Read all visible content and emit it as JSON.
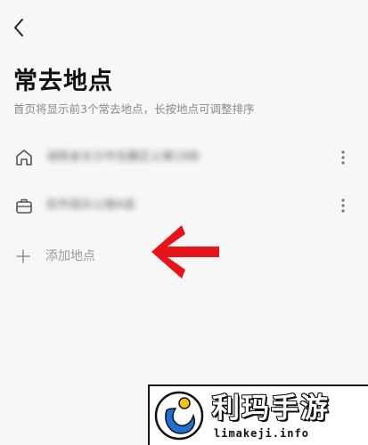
{
  "header": {
    "back_icon": "chevron-left-icon",
    "title": "常去地点",
    "subtitle": "首页将显示前3个常去地点，长按地点可调整排序"
  },
  "places": [
    {
      "icon": "home-icon",
      "label": "湖南省长沙市岳麓区公寓18栋",
      "more_icon": "more-vertical-icon"
    },
    {
      "icon": "briefcase-icon",
      "label": "软件园办公楼A座",
      "more_icon": "more-vertical-icon"
    }
  ],
  "add_place": {
    "icon": "plus-icon",
    "label": "添加地点"
  },
  "annotation": {
    "icon": "red-arrow-icon",
    "color": "#e8141c"
  },
  "watermark": {
    "name": "利玛手游",
    "domain": "limakeji.info"
  }
}
